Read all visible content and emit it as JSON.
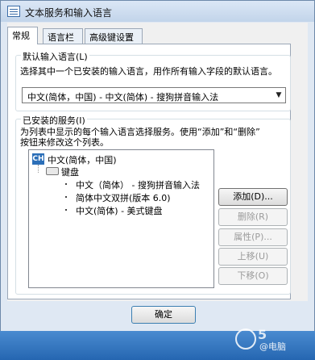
{
  "window": {
    "title": "文本服务和输入语言"
  },
  "tabs": [
    {
      "label": "常规",
      "active": true
    },
    {
      "label": "语言栏",
      "active": false
    },
    {
      "label": "高级键设置",
      "active": false
    }
  ],
  "default_language": {
    "group_title": "默认输入语言(L)",
    "description": "选择其中一个已安装的输入语言，用作所有输入字段的默认语言。",
    "selected": "中文(简体，中国) - 中文(简体) - 搜狗拼音输入法"
  },
  "installed_services": {
    "group_title": "已安装的服务(I)",
    "description_line1": "为列表中显示的每个输入语言选择服务。使用“添加”和“删除”",
    "description_line2": "按钮来修改这个列表。",
    "tree": {
      "language_badge": "CH",
      "language": "中文(简体，中国)",
      "category": "键盘",
      "services": [
        "中文（简体） - 搜狗拼音输入法",
        "简体中文双拼(版本 6.0)",
        "中文(简体) - 美式键盘"
      ]
    },
    "buttons": {
      "add": "添加(D)...",
      "remove": "删除(R)",
      "properties": "属性(P)...",
      "move_up": "上移(U)",
      "move_down": "下移(O)"
    }
  },
  "footer": {
    "ok_label": "确定"
  },
  "watermark": {
    "brand": "5",
    "text": "@电脑"
  },
  "colors": {
    "titlebar": "#c2d4ea",
    "taskbar": "#2566b1",
    "badge": "#2c6fb8"
  }
}
